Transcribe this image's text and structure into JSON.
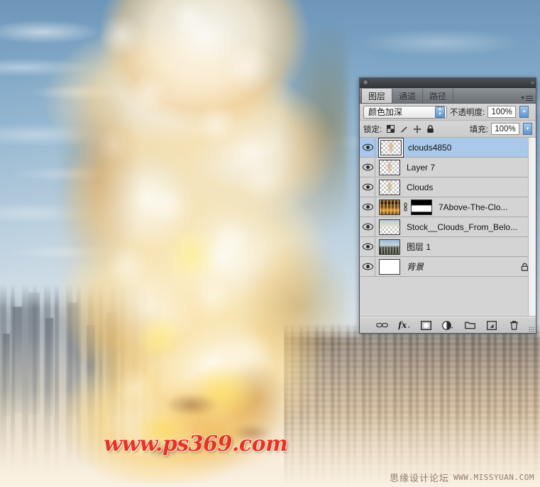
{
  "artwork": {
    "description": "Massive explosion mushroom cloud over a city skyline",
    "watermark_main": "www.ps369.com",
    "watermark_corner_cn": "思缘设计论坛",
    "watermark_corner_en": "WWW.MISSYUAN.COM",
    "colors": {
      "sky": "#7ea6c6",
      "plume_light": "#fffcf5",
      "plume_ochre": "#d6943a",
      "hot_yellow": "#ffe478",
      "watermark_red": "#e8331f"
    }
  },
  "panel": {
    "titlebar": {
      "collapse_icon": "collapse-chevrons-icon"
    },
    "tabs": [
      {
        "label": "图层",
        "active": true
      },
      {
        "label": "通道",
        "active": false
      },
      {
        "label": "路径",
        "active": false
      }
    ],
    "menu_icon": "panel-menu-icon",
    "blend_mode": {
      "value": "颜色加深"
    },
    "opacity": {
      "label": "不透明度:",
      "value": "100%"
    },
    "lock": {
      "label": "锁定:",
      "icons": [
        "lock-transparent-pixels-icon",
        "lock-image-pixels-icon",
        "lock-position-icon",
        "lock-all-icon"
      ]
    },
    "fill": {
      "label": "填充:",
      "value": "100%"
    },
    "layers": [
      {
        "name": "clouds4850",
        "visible": true,
        "selected": true,
        "thumb": "checker-cloud",
        "has_mask": false,
        "locked": false,
        "italic": false
      },
      {
        "name": "Layer 7",
        "visible": true,
        "selected": false,
        "thumb": "checker-cloud",
        "has_mask": false,
        "locked": false,
        "italic": false
      },
      {
        "name": "Clouds",
        "visible": true,
        "selected": false,
        "thumb": "checker-cloud",
        "has_mask": false,
        "locked": false,
        "italic": false
      },
      {
        "name": "7Above-The-Clo...",
        "visible": true,
        "selected": false,
        "thumb": "photo-fire",
        "has_mask": true,
        "locked": false,
        "italic": false
      },
      {
        "name": "Stock__Clouds_From_Belo...",
        "visible": true,
        "selected": false,
        "thumb": "stock-clouds",
        "has_mask": false,
        "locked": false,
        "italic": false
      },
      {
        "name": "图层 1",
        "visible": true,
        "selected": false,
        "thumb": "photo-city",
        "has_mask": false,
        "locked": false,
        "italic": false
      },
      {
        "name": "背景",
        "visible": true,
        "selected": false,
        "thumb": "white",
        "has_mask": false,
        "locked": true,
        "italic": true
      }
    ],
    "footer_buttons": [
      "link-layers-icon",
      "layer-styles-fx-icon",
      "add-layer-mask-icon",
      "new-fill-adjustment-layer-icon",
      "new-group-icon",
      "new-layer-icon",
      "delete-layer-icon"
    ]
  }
}
